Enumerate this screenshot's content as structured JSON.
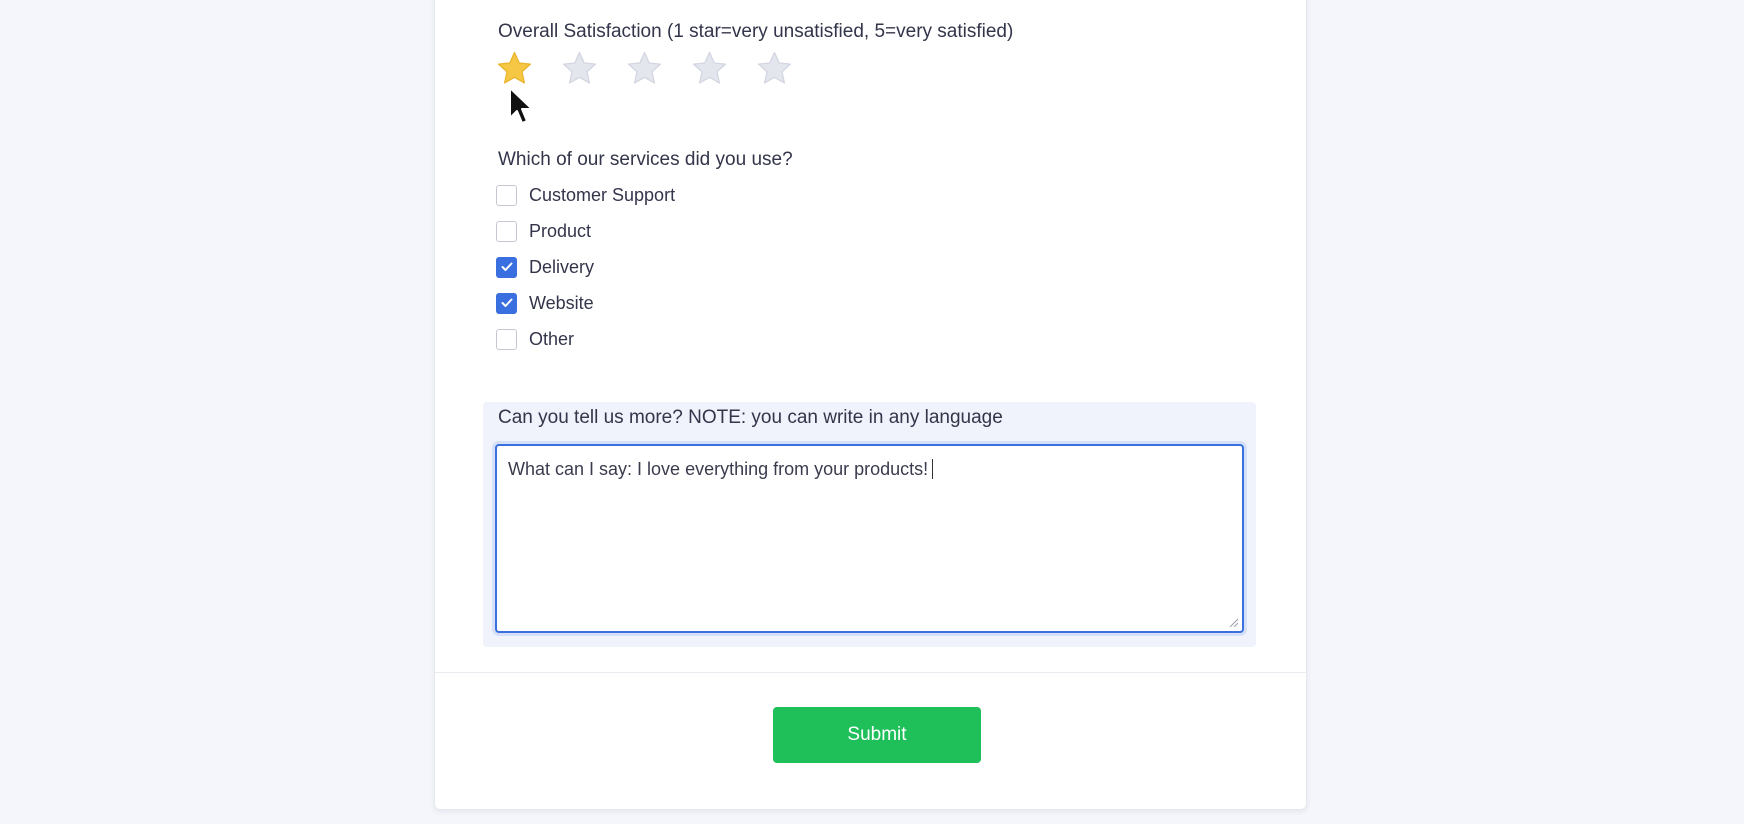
{
  "form": {
    "rating_question": "Overall Satisfaction (1 star=very unsatisfied, 5=very satisfied)",
    "rating": {
      "value": 1,
      "max": 5,
      "filled_color": "#f6c744",
      "empty_color": "#e4e6ee",
      "icon": "star-icon"
    },
    "services_question": "Which of our services did you use?",
    "services": [
      {
        "label": "Customer Support",
        "checked": false
      },
      {
        "label": "Product",
        "checked": false
      },
      {
        "label": "Delivery",
        "checked": true
      },
      {
        "label": "Website",
        "checked": true
      },
      {
        "label": "Other",
        "checked": false
      }
    ],
    "comment_question": "Can you tell us more? NOTE: you can write in any language",
    "comment_value": "What can I say: I love everything from your products!",
    "submit_label": "Submit"
  },
  "colors": {
    "accent": "#3a6fe0",
    "submit": "#1fbf5a"
  }
}
